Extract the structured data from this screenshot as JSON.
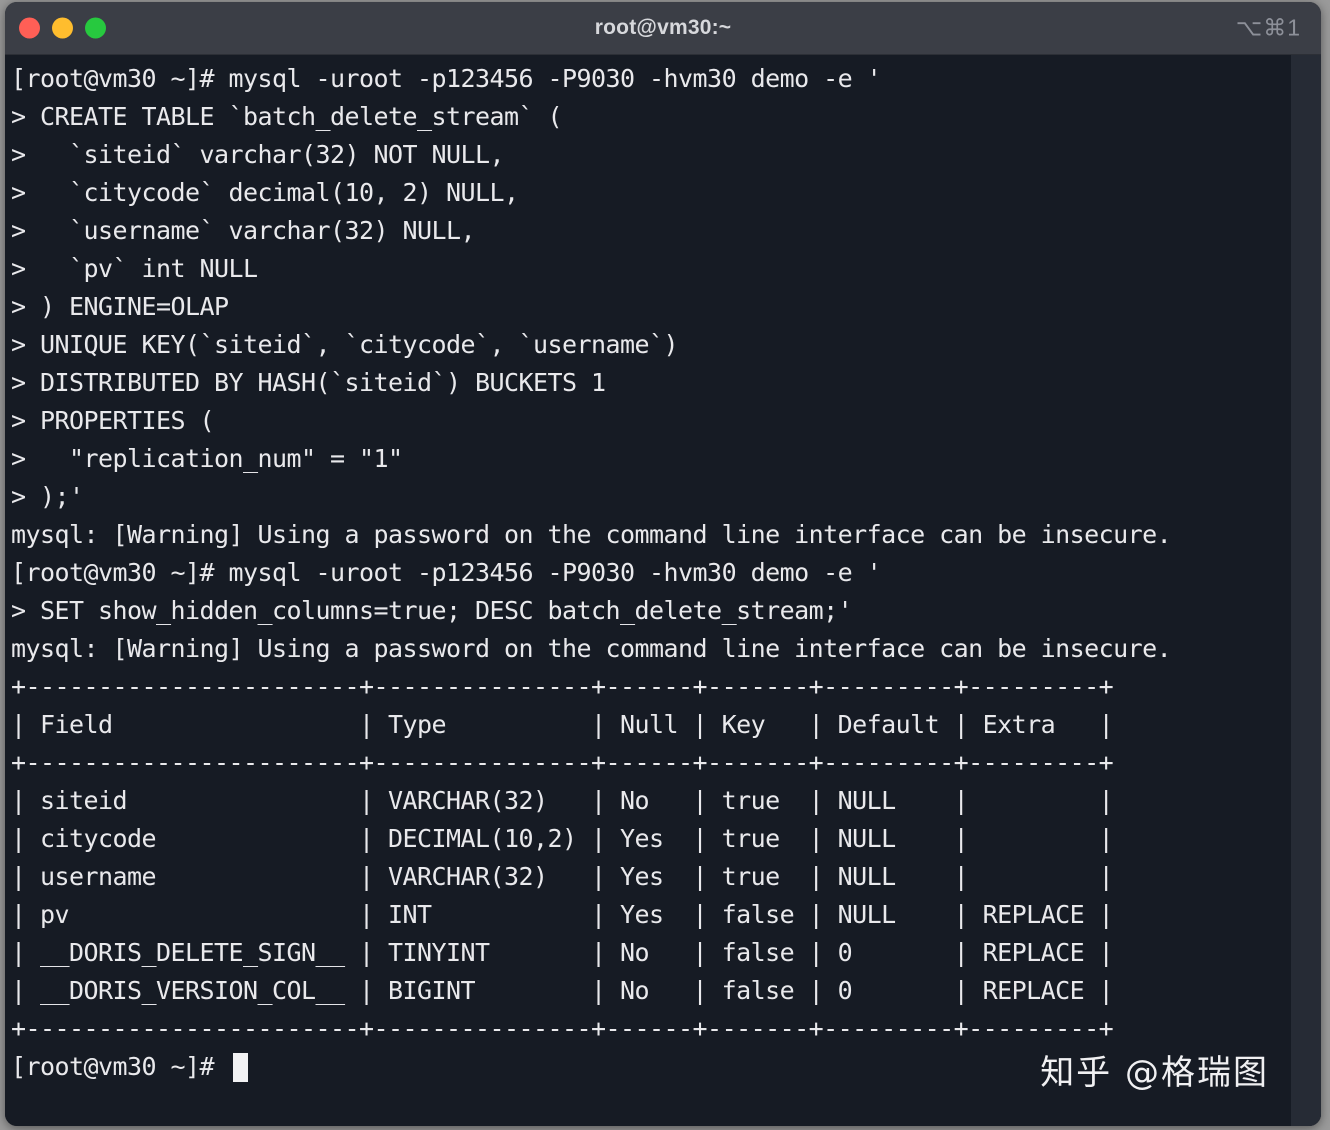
{
  "window": {
    "title": "root@vm30:~",
    "shortcut": "⌥⌘1",
    "traffic_lights": [
      {
        "name": "close",
        "color": "#ff5f56"
      },
      {
        "name": "minimize",
        "color": "#ffbd2e"
      },
      {
        "name": "maximize",
        "color": "#27c93f"
      }
    ],
    "background_color": "#161b24",
    "titlebar_color": "#3b3e46",
    "text_color": "#e9e9ec"
  },
  "terminal": {
    "lines": [
      "[root@vm30 ~]# mysql -uroot -p123456 -P9030 -hvm30 demo -e '",
      "> CREATE TABLE `batch_delete_stream` (",
      ">   `siteid` varchar(32) NOT NULL,",
      ">   `citycode` decimal(10, 2) NULL,",
      ">   `username` varchar(32) NULL,",
      ">   `pv` int NULL",
      "> ) ENGINE=OLAP",
      "> UNIQUE KEY(`siteid`, `citycode`, `username`)",
      "> DISTRIBUTED BY HASH(`siteid`) BUCKETS 1",
      "> PROPERTIES (",
      ">   \"replication_num\" = \"1\"",
      "> );'",
      "mysql: [Warning] Using a password on the command line interface can be insecure.",
      "[root@vm30 ~]# mysql -uroot -p123456 -P9030 -hvm30 demo -e '",
      "> SET show_hidden_columns=true; DESC batch_delete_stream;'",
      "mysql: [Warning] Using a password on the command line interface can be insecure.",
      "+-----------------------+---------------+------+-------+---------+---------+",
      "| Field                 | Type          | Null | Key   | Default | Extra   |",
      "+-----------------------+---------------+------+-------+---------+---------+",
      "| siteid                | VARCHAR(32)   | No   | true  | NULL    |         |",
      "| citycode              | DECIMAL(10,2) | Yes  | true  | NULL    |         |",
      "| username              | VARCHAR(32)   | Yes  | true  | NULL    |         |",
      "| pv                    | INT           | Yes  | false | NULL    | REPLACE |",
      "| __DORIS_DELETE_SIGN__ | TINYINT       | No   | false | 0       | REPLACE |",
      "| __DORIS_VERSION_COL__ | BIGINT        | No   | false | 0       | REPLACE |",
      "+-----------------------+---------------+------+-------+---------+---------+"
    ],
    "prompt": "[root@vm30 ~]# ",
    "cursor": "block"
  },
  "desc_table": {
    "type": "table",
    "columns": [
      "Field",
      "Type",
      "Null",
      "Key",
      "Default",
      "Extra"
    ],
    "rows": [
      [
        "siteid",
        "VARCHAR(32)",
        "No",
        "true",
        "NULL",
        ""
      ],
      [
        "citycode",
        "DECIMAL(10,2)",
        "Yes",
        "true",
        "NULL",
        ""
      ],
      [
        "username",
        "VARCHAR(32)",
        "Yes",
        "true",
        "NULL",
        ""
      ],
      [
        "pv",
        "INT",
        "Yes",
        "false",
        "NULL",
        "REPLACE"
      ],
      [
        "__DORIS_DELETE_SIGN__",
        "TINYINT",
        "No",
        "false",
        "0",
        "REPLACE"
      ],
      [
        "__DORIS_VERSION_COL__",
        "BIGINT",
        "No",
        "false",
        "0",
        "REPLACE"
      ]
    ]
  },
  "watermark": {
    "text": "知乎 @格瑞图"
  }
}
